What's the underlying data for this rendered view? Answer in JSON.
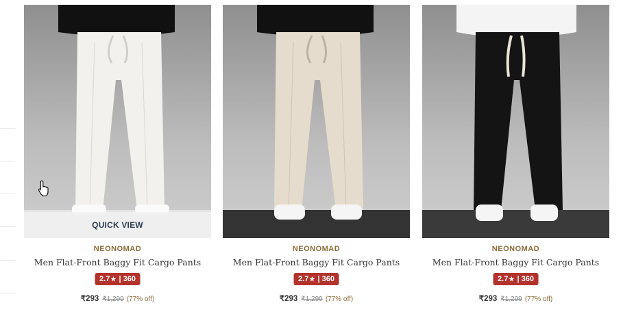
{
  "products": [
    {
      "brand": "NEONOMAD",
      "title": "Men Flat-Front Baggy Fit Cargo Pants",
      "rating": "2.7",
      "rating_count": "360",
      "price": "₹293",
      "mrp": "₹1,299",
      "discount": "(77% off)",
      "quick_view": "QUICK VIEW",
      "pants_color": "#f2f1ee",
      "top_color": "#111111"
    },
    {
      "brand": "NEONOMAD",
      "title": "Men Flat-Front Baggy Fit Cargo Pants",
      "rating": "2.7",
      "rating_count": "360",
      "price": "₹293",
      "mrp": "₹1,299",
      "discount": "(77% off)",
      "pants_color": "#e6dccd",
      "top_color": "#111111"
    },
    {
      "brand": "NEONOMAD",
      "title": "Men Flat-Front Baggy Fit Cargo Pants",
      "rating": "2.7",
      "rating_count": "360",
      "price": "₹293",
      "mrp": "₹1,299",
      "discount": "(77% off)",
      "pants_color": "#141414",
      "top_color": "#f4f4f4"
    }
  ],
  "colors": {
    "brand": "#8b6b3a",
    "rating_badge": "#b3332c",
    "quick_view_text": "#2c3e50"
  },
  "icons": {
    "star": "star-icon",
    "cursor": "hand-pointer-icon"
  }
}
